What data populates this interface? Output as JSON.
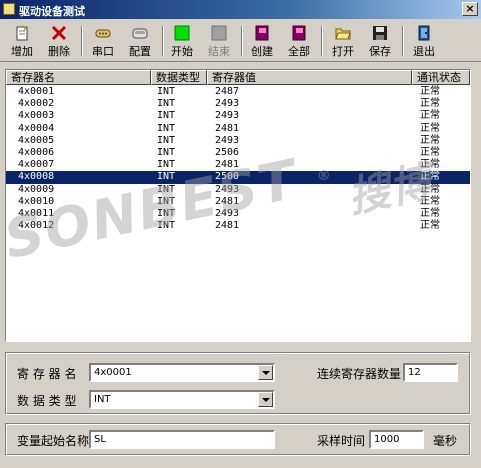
{
  "window": {
    "title": "驱动设备测试",
    "close_glyph": "×"
  },
  "toolbar": {
    "buttons": [
      {
        "label": "增加",
        "icon": "add-document-icon"
      },
      {
        "label": "删除",
        "icon": "delete-x-icon"
      },
      {
        "label": "串口",
        "icon": "serial-port-icon"
      },
      {
        "label": "配置",
        "icon": "config-icon"
      },
      {
        "label": "开始",
        "icon": "start-green-icon"
      },
      {
        "label": "结束",
        "icon": "stop-gray-icon"
      },
      {
        "label": "创建",
        "icon": "create-book-icon"
      },
      {
        "label": "全部",
        "icon": "all-book-icon"
      },
      {
        "label": "打开",
        "icon": "open-folder-icon"
      },
      {
        "label": "保存",
        "icon": "save-disk-icon"
      },
      {
        "label": "退出",
        "icon": "exit-door-icon"
      }
    ]
  },
  "list": {
    "columns": [
      "寄存器名",
      "数据类型",
      "寄存器值",
      "通讯状态"
    ],
    "rows": [
      {
        "name": "4x0001",
        "type": "INT",
        "value": "2487",
        "status": "正常"
      },
      {
        "name": "4x0002",
        "type": "INT",
        "value": "2493",
        "status": "正常"
      },
      {
        "name": "4x0003",
        "type": "INT",
        "value": "2493",
        "status": "正常"
      },
      {
        "name": "4x0004",
        "type": "INT",
        "value": "2481",
        "status": "正常"
      },
      {
        "name": "4x0005",
        "type": "INT",
        "value": "2493",
        "status": "正常"
      },
      {
        "name": "4x0006",
        "type": "INT",
        "value": "2506",
        "status": "正常"
      },
      {
        "name": "4x0007",
        "type": "INT",
        "value": "2481",
        "status": "正常"
      },
      {
        "name": "4x0008",
        "type": "INT",
        "value": "2500",
        "status": "正常",
        "selected": true
      },
      {
        "name": "4x0009",
        "type": "INT",
        "value": "2493",
        "status": "正常"
      },
      {
        "name": "4x0010",
        "type": "INT",
        "value": "2481",
        "status": "正常"
      },
      {
        "name": "4x0011",
        "type": "INT",
        "value": "2493",
        "status": "正常"
      },
      {
        "name": "4x0012",
        "type": "INT",
        "value": "2481",
        "status": "正常"
      }
    ]
  },
  "watermark": {
    "text": "SONBEST",
    "reg": "®",
    "cn": "搜博"
  },
  "settings": {
    "register_label": "寄 存 器 名",
    "register_value": "4x0001",
    "datatype_label": "数 据 类 型",
    "datatype_value": "INT",
    "count_label": "连续寄存器数量",
    "count_value": "12"
  },
  "variable": {
    "start_name_label": "变量起始名称",
    "start_name_value": "SL",
    "sample_time_label": "采样时间",
    "sample_time_value": "1000",
    "unit": "毫秒"
  },
  "colors": {
    "selection": "#0a246a",
    "titlebar": "#0a246a",
    "face": "#d4d0c8"
  }
}
